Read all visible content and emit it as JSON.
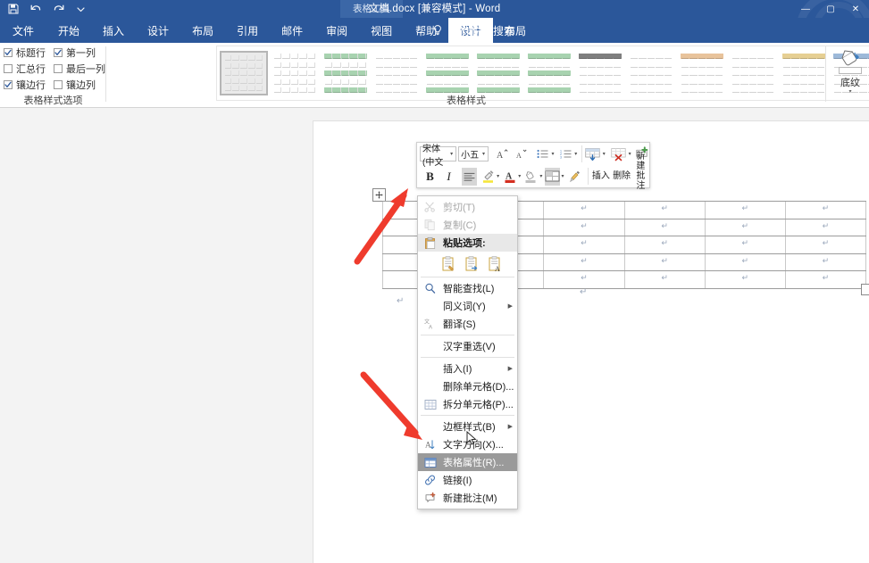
{
  "titlebar": {
    "document_title": "文档.docx [兼容模式]  -  Word",
    "contextual_tool_tab": "表格工具",
    "quick_access": [
      {
        "name": "save-icon",
        "label": "保存"
      },
      {
        "name": "undo-icon",
        "label": "撤消"
      },
      {
        "name": "redo-icon",
        "label": "恢复"
      },
      {
        "name": "customize-qat-icon",
        "label": "自定义快速访问工具栏"
      }
    ],
    "window_controls": [
      {
        "name": "minimize-button",
        "glyph": "—"
      },
      {
        "name": "maximize-button",
        "glyph": "▢"
      },
      {
        "name": "close-button",
        "glyph": "✕"
      }
    ]
  },
  "ribbon_tabs": [
    {
      "label": "文件",
      "active": false
    },
    {
      "label": "开始",
      "active": false
    },
    {
      "label": "插入",
      "active": false
    },
    {
      "label": "设计",
      "active": false
    },
    {
      "label": "布局",
      "active": false
    },
    {
      "label": "引用",
      "active": false
    },
    {
      "label": "邮件",
      "active": false
    },
    {
      "label": "审阅",
      "active": false
    },
    {
      "label": "视图",
      "active": false
    },
    {
      "label": "帮助",
      "active": false
    },
    {
      "label": "设计",
      "active": true
    },
    {
      "label": "布局",
      "active": false
    }
  ],
  "tell_me": {
    "label": "操作说明搜索",
    "icon": "lightbulb-icon"
  },
  "ribbon": {
    "table_style_options": {
      "group_label": "表格样式选项",
      "checkboxes": [
        {
          "label": "标题行",
          "checked": true
        },
        {
          "label": "第一列",
          "checked": true
        },
        {
          "label": "汇总行",
          "checked": false
        },
        {
          "label": "最后一列",
          "checked": false
        },
        {
          "label": "镶边行",
          "checked": true
        },
        {
          "label": "镶边列",
          "checked": false
        }
      ]
    },
    "table_styles": {
      "group_label": "表格样式",
      "selected_index": 0,
      "thumbnails": [
        {
          "name": "plain-table-grid",
          "accent": "#9a9a9a",
          "banded": false,
          "header": false
        },
        {
          "name": "plain-table-light",
          "accent": "#cfcfcf",
          "banded": false,
          "header": false
        },
        {
          "name": "green-banded-1",
          "accent": "#a8d3b0",
          "banded": true,
          "header": true
        },
        {
          "name": "light-list",
          "accent": "#d8d8d8",
          "banded": false,
          "header": false
        },
        {
          "name": "green-banded-2",
          "accent": "#a8d3b0",
          "banded": true,
          "header": true
        },
        {
          "name": "green-banded-3",
          "accent": "#a8d3b0",
          "banded": true,
          "header": true
        },
        {
          "name": "green-first-column",
          "accent": "#a8d3b0",
          "banded": true,
          "header": true
        },
        {
          "name": "grid-table-dark-top",
          "accent": "#7f7f7f",
          "banded": false,
          "header": true
        },
        {
          "name": "blue-grid-table",
          "accent": "#b8cbe4",
          "banded": false,
          "header": false
        },
        {
          "name": "orange-grid-table",
          "accent": "#e8c39b",
          "banded": false,
          "header": true
        },
        {
          "name": "blue-light-table",
          "accent": "#c4d5ea",
          "banded": false,
          "header": false
        },
        {
          "name": "gold-grid-table",
          "accent": "#e6cf93",
          "banded": false,
          "header": true
        },
        {
          "name": "blue-top-table",
          "accent": "#9db9d9",
          "banded": false,
          "header": true
        },
        {
          "name": "green-light-table",
          "accent": "#c5dcb4",
          "banded": false,
          "header": false
        }
      ],
      "scroll_buttons": [
        "▲",
        "▼",
        "▾"
      ]
    },
    "shading": {
      "label": "底纹",
      "icon": "paint-bucket-icon",
      "swatch_color": "#ffffff",
      "dropdown_caret": "▾"
    }
  },
  "mini_toolbar": {
    "font_name": "宋体 (中文",
    "font_size": "小五",
    "row1_buttons": [
      {
        "name": "grow-font-icon",
        "label": "A"
      },
      {
        "name": "shrink-font-icon",
        "label": "A"
      },
      {
        "name": "bullets-icon",
        "label": "≔"
      },
      {
        "name": "numbering-icon",
        "label": "≔"
      }
    ],
    "row2_buttons": [
      {
        "name": "bold-button",
        "label": "B"
      },
      {
        "name": "italic-button",
        "label": "I"
      },
      {
        "name": "align-button",
        "label": "≡"
      },
      {
        "name": "highlight-color-button",
        "label": "✎"
      },
      {
        "name": "font-color-button",
        "label": "A"
      },
      {
        "name": "shading-color-button",
        "label": "◇"
      },
      {
        "name": "borders-button",
        "label": "⊞"
      },
      {
        "name": "format-painter-button",
        "label": "✦"
      }
    ],
    "table_actions": [
      {
        "name": "insert-cells-button",
        "label": "插入",
        "caret": "▾"
      },
      {
        "name": "delete-cells-button",
        "label": "删除",
        "caret": "▾"
      },
      {
        "name": "new-comment-button",
        "label": "新建\n批注",
        "label_line1": "新建",
        "label_line2": "批注"
      }
    ]
  },
  "context_menu": {
    "items": [
      {
        "label": "剪切(T)",
        "icon": "scissors-icon",
        "disabled": true,
        "submenu": false,
        "highlighted": false
      },
      {
        "label": "复制(C)",
        "icon": "copy-icon",
        "disabled": true,
        "submenu": false,
        "highlighted": false
      },
      {
        "label": "粘贴选项:",
        "icon": "paste-icon",
        "header": true,
        "submenu": false,
        "highlighted": false
      },
      {
        "label": "智能查找(L)",
        "icon": "magnifier-icon",
        "disabled": false,
        "submenu": false,
        "highlighted": false
      },
      {
        "label": "同义词(Y)",
        "icon": "",
        "disabled": false,
        "submenu": true,
        "highlighted": false
      },
      {
        "label": "翻译(S)",
        "icon": "translate-icon",
        "disabled": false,
        "submenu": false,
        "highlighted": false
      },
      {
        "label": "汉字重选(V)",
        "icon": "",
        "disabled": false,
        "submenu": false,
        "highlighted": false
      },
      {
        "label": "插入(I)",
        "icon": "",
        "disabled": false,
        "submenu": true,
        "highlighted": false
      },
      {
        "label": "删除单元格(D)...",
        "icon": "",
        "disabled": false,
        "submenu": false,
        "highlighted": false
      },
      {
        "label": "拆分单元格(P)...",
        "icon": "split-cells-icon",
        "disabled": false,
        "submenu": false,
        "highlighted": false
      },
      {
        "label": "边框样式(B)",
        "icon": "",
        "disabled": false,
        "submenu": true,
        "highlighted": false
      },
      {
        "label": "文字方向(X)...",
        "icon": "text-direction-icon",
        "disabled": false,
        "submenu": false,
        "highlighted": false
      },
      {
        "label": "表格属性(R)...",
        "icon": "table-properties-icon",
        "disabled": false,
        "submenu": false,
        "highlighted": true
      },
      {
        "label": "链接(I)",
        "icon": "hyperlink-icon",
        "disabled": false,
        "submenu": false,
        "highlighted": false
      },
      {
        "label": "新建批注(M)",
        "icon": "new-comment-icon",
        "disabled": false,
        "submenu": false,
        "highlighted": false
      }
    ],
    "paste_options": [
      {
        "name": "paste-keep-source-formatting-icon"
      },
      {
        "name": "paste-merge-formatting-icon"
      },
      {
        "name": "paste-keep-text-only-icon"
      }
    ]
  },
  "document": {
    "table": {
      "rows": 5,
      "columns": 6,
      "cell_mark": "↵"
    },
    "paragraph_mark": "↵",
    "table_move_handle": "move-handle-icon",
    "table_resize_handle": "resize-handle-icon"
  },
  "annotations": {
    "arrow_color": "#ef3b2d",
    "arrows": [
      {
        "name": "arrow-to-table-handle"
      },
      {
        "name": "arrow-to-table-properties"
      }
    ]
  }
}
